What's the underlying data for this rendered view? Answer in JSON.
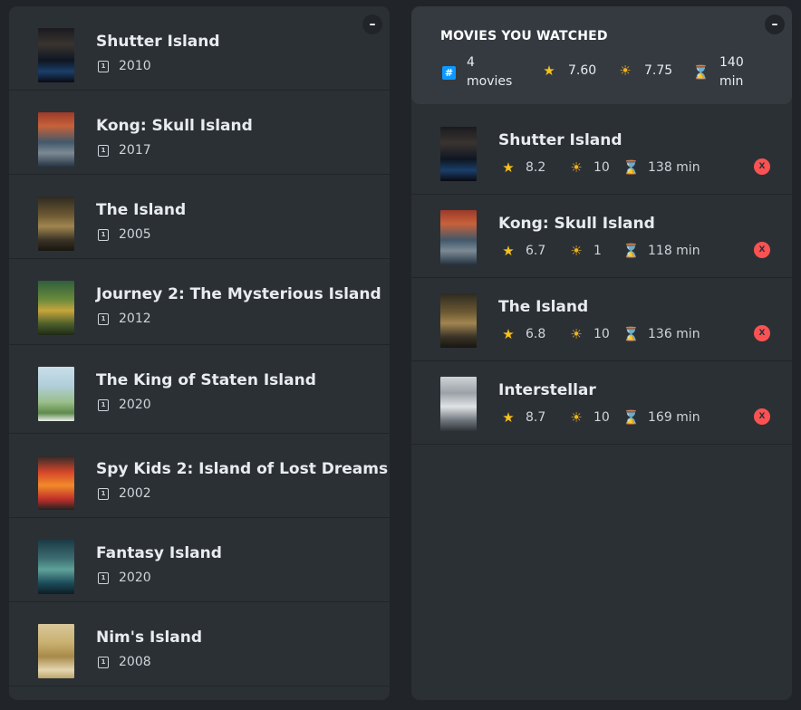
{
  "search_results": {
    "toggle_label": "–",
    "movies": [
      {
        "title": "Shutter Island",
        "year": "2010",
        "poster": "p-shutter"
      },
      {
        "title": "Kong: Skull Island",
        "year": "2017",
        "poster": "p-kong"
      },
      {
        "title": "The Island",
        "year": "2005",
        "poster": "p-island"
      },
      {
        "title": "Journey 2: The Mysterious Island",
        "year": "2012",
        "poster": "p-journey"
      },
      {
        "title": "The King of Staten Island",
        "year": "2020",
        "poster": "p-staten"
      },
      {
        "title": "Spy Kids 2: Island of Lost Dreams",
        "year": "2002",
        "poster": "p-spykids"
      },
      {
        "title": "Fantasy Island",
        "year": "2020",
        "poster": "p-fantasy"
      },
      {
        "title": "Nim's Island",
        "year": "2008",
        "poster": "p-nims"
      }
    ]
  },
  "summary": {
    "toggle_label": "–",
    "heading": "MOVIES YOU WATCHED",
    "count_value": "4",
    "count_unit": "movies",
    "avg_imdb_rating": "7.60",
    "avg_user_rating": "7.75",
    "avg_runtime_value": "140",
    "avg_runtime_unit": "min",
    "icons": {
      "count": "hash-icon",
      "imdb": "star-icon",
      "user": "sun-icon",
      "runtime": "hourglass-icon"
    }
  },
  "watched": [
    {
      "title": "Shutter Island",
      "imdb": "8.2",
      "user": "10",
      "runtime": "138 min",
      "poster": "p-shutter"
    },
    {
      "title": "Kong: Skull Island",
      "imdb": "6.7",
      "user": "1",
      "runtime": "118 min",
      "poster": "p-kong"
    },
    {
      "title": "The Island",
      "imdb": "6.8",
      "user": "10",
      "runtime": "136 min",
      "poster": "p-island"
    },
    {
      "title": "Interstellar",
      "imdb": "8.7",
      "user": "10",
      "runtime": "169 min",
      "poster": "p-interstellar"
    }
  ],
  "remove_label": "X",
  "colors": {
    "background": "#212529",
    "box": "#2b3035",
    "summary": "#343a40",
    "accent_remove": "#fa5252",
    "star": "#f7c21b"
  }
}
